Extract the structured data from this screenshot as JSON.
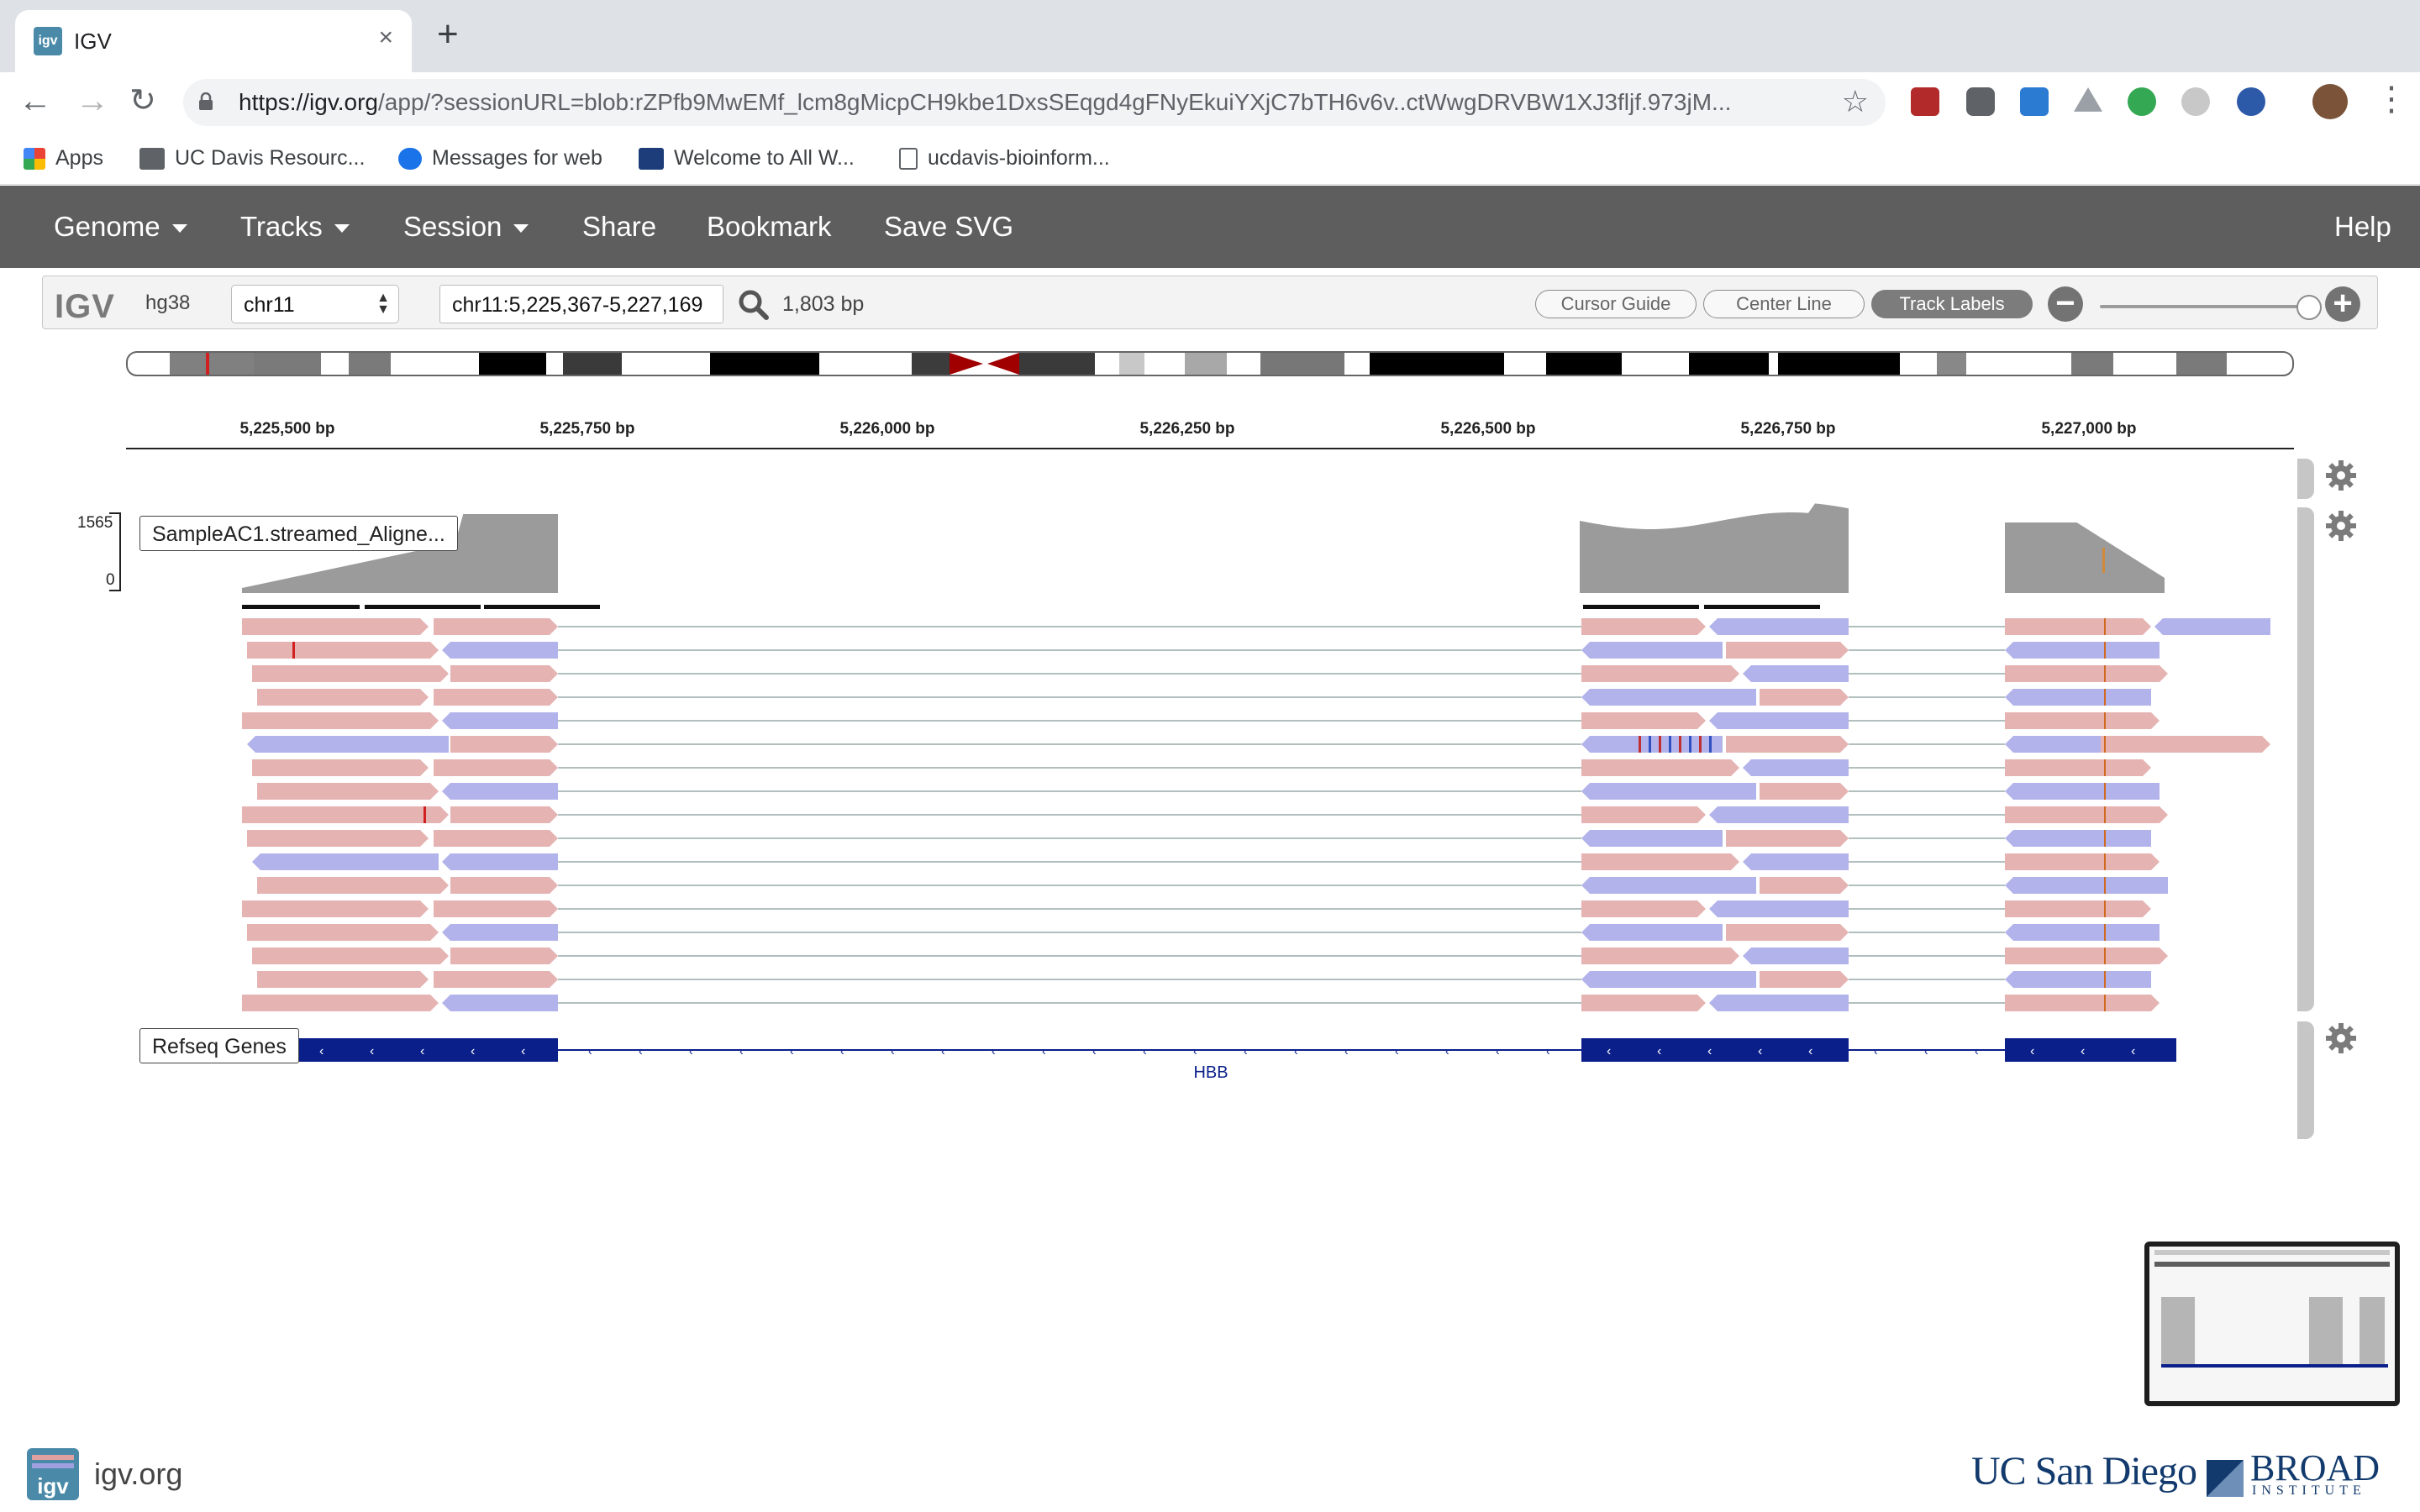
{
  "browser": {
    "tab_title": "IGV",
    "tab_close": "×",
    "new_tab": "+",
    "url_host": "https://igv.org",
    "url_rest": "/app/?sessionURL=blob:rZPfb9MwEMf_lcm8gMicpCH9kbe1DxsSEqgd4gFNyEkuiYXjC7bTH6v6v..ctWwgDRVBW1XJ3fljf.973jM...",
    "bookmarks": [
      "Apps",
      "UC Davis Resourc...",
      "Messages for web",
      "Welcome to All W...",
      "ucdavis-bioinform..."
    ]
  },
  "igv_nav": {
    "items": [
      "Genome",
      "Tracks",
      "Session",
      "Share",
      "Bookmark",
      "Save SVG"
    ],
    "help": "Help"
  },
  "controls": {
    "logo": "IGV",
    "genome": "hg38",
    "chromosome": "chr11",
    "locus": "chr11:5,225,367-5,227,169",
    "bp_count": "1,803 bp",
    "cursor_guide": "Cursor Guide",
    "center_line": "Center Line",
    "track_labels": "Track Labels",
    "zoom_out": "−",
    "zoom_in": "+"
  },
  "ruler": {
    "ticks": [
      "5,225,500 bp",
      "5,225,750 bp",
      "5,226,000 bp",
      "5,226,250 bp",
      "5,226,500 bp",
      "5,226,750 bp",
      "5,227,000 bp"
    ]
  },
  "tracks": {
    "alignment_label": "SampleAC1.streamed_Aligne...",
    "coverage_max": "1565",
    "coverage_min": "0",
    "genes_label": "Refseq Genes",
    "gene_name": "HBB"
  },
  "colors": {
    "forward_read": "#e6b3b3",
    "reverse_read": "#b3b3ec",
    "gene": "#0a1f8a",
    "coverage": "#9b9b9b",
    "navbar": "#5e5e5e"
  },
  "footer": {
    "site": "igv.org",
    "uc": "UC San Diego",
    "broad_top": "BROAD",
    "broad_bottom": "INSTITUTE"
  }
}
